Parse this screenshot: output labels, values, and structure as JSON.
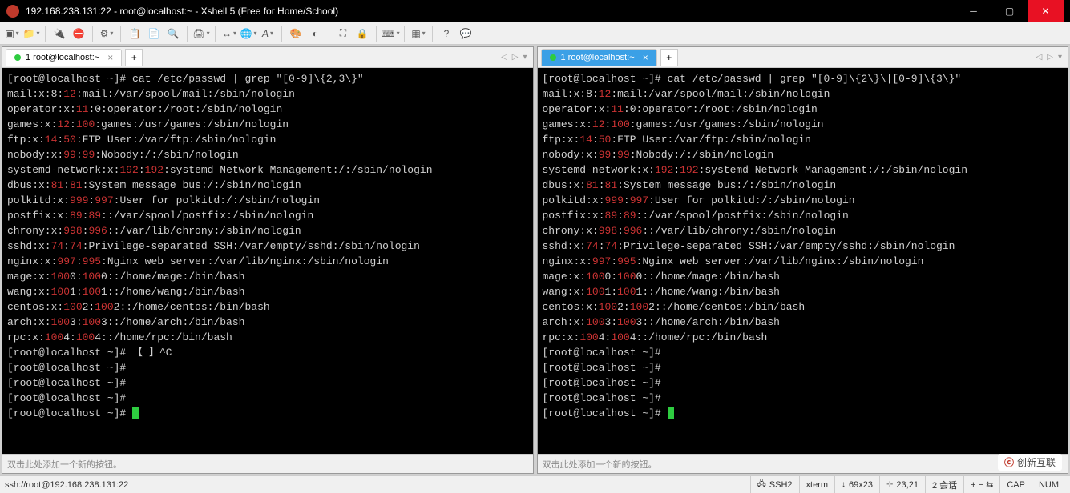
{
  "window": {
    "title": "192.168.238.131:22 - root@localhost:~ - Xshell 5 (Free for Home/School)"
  },
  "tabs": {
    "left": {
      "label": "1 root@localhost:~"
    },
    "right": {
      "label": "1 root@localhost:~"
    }
  },
  "terminal_left": {
    "cmd": "[root@localhost ~]# cat /etc/passwd | grep \"[0-9]\\{2,3\\}\"",
    "lines": [
      {
        "pre": "mail:x:8:",
        "hl": "12",
        "post": ":mail:/var/spool/mail:/sbin/nologin"
      },
      {
        "pre": "operator:x:",
        "hl": "11",
        "post": ":0:operator:/root:/sbin/nologin"
      },
      {
        "pre": "games:x:",
        "hl": "12",
        "mid": ":",
        "hl2": "100",
        "post": ":games:/usr/games:/sbin/nologin"
      },
      {
        "pre": "ftp:x:",
        "hl": "14",
        "mid": ":",
        "hl2": "50",
        "post": ":FTP User:/var/ftp:/sbin/nologin"
      },
      {
        "pre": "nobody:x:",
        "hl": "99",
        "mid": ":",
        "hl2": "99",
        "post": ":Nobody:/:/sbin/nologin"
      },
      {
        "pre": "systemd-network:x:",
        "hl": "192",
        "mid": ":",
        "hl2": "192",
        "post": ":systemd Network Management:/:/sbin/nologin"
      },
      {
        "pre": "dbus:x:",
        "hl": "81",
        "mid": ":",
        "hl2": "81",
        "post": ":System message bus:/:/sbin/nologin"
      },
      {
        "pre": "polkitd:x:",
        "hl": "999",
        "mid": ":",
        "hl2": "997",
        "post": ":User for polkitd:/:/sbin/nologin"
      },
      {
        "pre": "postfix:x:",
        "hl": "89",
        "mid": ":",
        "hl2": "89",
        "post": "::/var/spool/postfix:/sbin/nologin"
      },
      {
        "pre": "chrony:x:",
        "hl": "998",
        "mid": ":",
        "hl2": "996",
        "post": "::/var/lib/chrony:/sbin/nologin"
      },
      {
        "pre": "sshd:x:",
        "hl": "74",
        "mid": ":",
        "hl2": "74",
        "post": ":Privilege-separated SSH:/var/empty/sshd:/sbin/nologin"
      },
      {
        "pre": "nginx:x:",
        "hl": "997",
        "mid": ":",
        "hl2": "995",
        "post": ":Nginx web server:/var/lib/nginx:/sbin/nologin"
      },
      {
        "pre": "mage:x:",
        "hl": "100",
        "mid": "0:",
        "hl2": "100",
        "post": "0::/home/mage:/bin/bash"
      },
      {
        "pre": "wang:x:",
        "hl": "100",
        "mid": "1:",
        "hl2": "100",
        "post": "1::/home/wang:/bin/bash"
      },
      {
        "pre": "centos:x:",
        "hl": "100",
        "mid": "2:",
        "hl2": "100",
        "post": "2::/home/centos:/bin/bash"
      },
      {
        "pre": "arch:x:",
        "hl": "100",
        "mid": "3:",
        "hl2": "100",
        "post": "3::/home/arch:/bin/bash"
      },
      {
        "pre": "rpc:x:",
        "hl": "100",
        "mid": "4:",
        "hl2": "100",
        "post": "4::/home/rpc:/bin/bash"
      }
    ],
    "prompt_brackets": "[root@localhost ~]# 【 】^C",
    "prompt": "[root@localhost ~]#",
    "prompt_count": 4
  },
  "terminal_right": {
    "cmd": "[root@localhost ~]# cat /etc/passwd | grep \"[0-9]\\{2\\}\\|[0-9]\\{3\\}\"",
    "lines": [
      {
        "pre": "mail:x:8:",
        "hl": "12",
        "post": ":mail:/var/spool/mail:/sbin/nologin"
      },
      {
        "pre": "operator:x:",
        "hl": "11",
        "post": ":0:operator:/root:/sbin/nologin"
      },
      {
        "pre": "games:x:",
        "hl": "12",
        "mid": ":",
        "hl2": "100",
        "post": ":games:/usr/games:/sbin/nologin"
      },
      {
        "pre": "ftp:x:",
        "hl": "14",
        "mid": ":",
        "hl2": "50",
        "post": ":FTP User:/var/ftp:/sbin/nologin"
      },
      {
        "pre": "nobody:x:",
        "hl": "99",
        "mid": ":",
        "hl2": "99",
        "post": ":Nobody:/:/sbin/nologin"
      },
      {
        "pre": "systemd-network:x:",
        "hl": "192",
        "mid": ":",
        "hl2": "192",
        "post": ":systemd Network Management:/:/sbin/nologin"
      },
      {
        "pre": "dbus:x:",
        "hl": "81",
        "mid": ":",
        "hl2": "81",
        "post": ":System message bus:/:/sbin/nologin"
      },
      {
        "pre": "polkitd:x:",
        "hl": "999",
        "mid": ":",
        "hl2": "997",
        "post": ":User for polkitd:/:/sbin/nologin"
      },
      {
        "pre": "postfix:x:",
        "hl": "89",
        "mid": ":",
        "hl2": "89",
        "post": "::/var/spool/postfix:/sbin/nologin"
      },
      {
        "pre": "chrony:x:",
        "hl": "998",
        "mid": ":",
        "hl2": "996",
        "post": "::/var/lib/chrony:/sbin/nologin"
      },
      {
        "pre": "sshd:x:",
        "hl": "74",
        "mid": ":",
        "hl2": "74",
        "post": ":Privilege-separated SSH:/var/empty/sshd:/sbin/nologin"
      },
      {
        "pre": "nginx:x:",
        "hl": "997",
        "mid": ":",
        "hl2": "995",
        "post": ":Nginx web server:/var/lib/nginx:/sbin/nologin"
      },
      {
        "pre": "mage:x:",
        "hl": "100",
        "mid": "0:",
        "hl2": "100",
        "post": "0::/home/mage:/bin/bash"
      },
      {
        "pre": "wang:x:",
        "hl": "100",
        "mid": "1:",
        "hl2": "100",
        "post": "1::/home/wang:/bin/bash"
      },
      {
        "pre": "centos:x:",
        "hl": "100",
        "mid": "2:",
        "hl2": "100",
        "post": "2::/home/centos:/bin/bash"
      },
      {
        "pre": "arch:x:",
        "hl": "100",
        "mid": "3:",
        "hl2": "100",
        "post": "3::/home/arch:/bin/bash"
      },
      {
        "pre": "rpc:x:",
        "hl": "100",
        "mid": "4:",
        "hl2": "100",
        "post": "4::/home/rpc:/bin/bash"
      }
    ],
    "prompt": "[root@localhost ~]#",
    "prompt_count": 4
  },
  "hint": "双击此处添加一个新的按钮。",
  "status": {
    "left": "ssh://root@192.168.238.131:22",
    "ssh": "SSH2",
    "term": "xterm",
    "size": "69x23",
    "pos": "23,21",
    "sessions": "2 会话",
    "caps": "CAP",
    "num": "NUM"
  },
  "watermark": "创新互联"
}
